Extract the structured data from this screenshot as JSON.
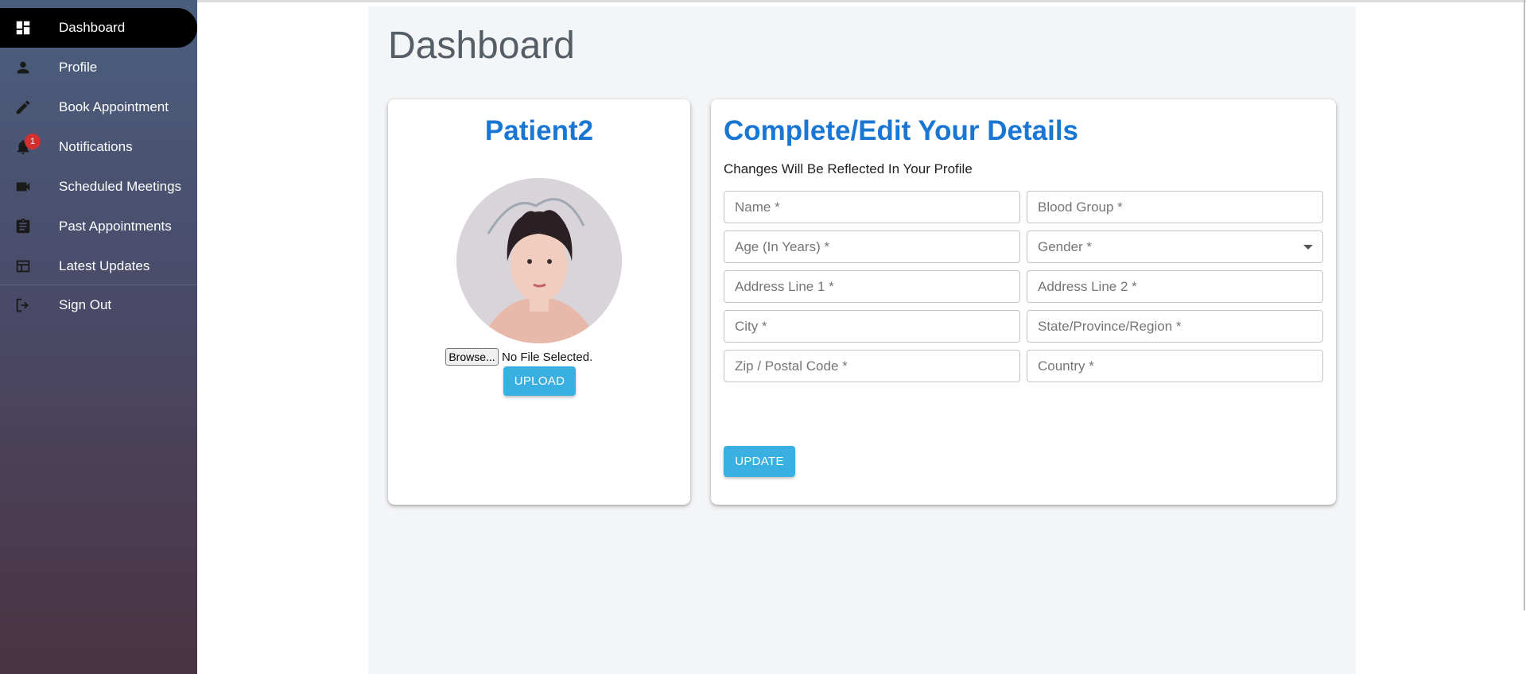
{
  "sidebar": {
    "items": [
      {
        "label": "Dashboard",
        "icon": "dashboard-icon",
        "active": true
      },
      {
        "label": "Profile",
        "icon": "person-icon"
      },
      {
        "label": "Book Appointment",
        "icon": "pencil-icon"
      },
      {
        "label": "Notifications",
        "icon": "bell-icon",
        "badge": "1"
      },
      {
        "label": "Scheduled Meetings",
        "icon": "video-camera-icon"
      },
      {
        "label": "Past Appointments",
        "icon": "clipboard-icon"
      },
      {
        "label": "Latest Updates",
        "icon": "table-icon"
      },
      {
        "label": "Sign Out",
        "icon": "sign-out-icon"
      }
    ]
  },
  "main": {
    "title": "Dashboard",
    "profile_card": {
      "name": "Patient2",
      "browse_label": "Browse...",
      "file_status": "No File Selected.",
      "upload_label": "UPLOAD"
    },
    "details_card": {
      "title": "Complete/Edit Your Details",
      "subtitle": "Changes Will Be Reflected In Your Profile",
      "fields": [
        {
          "label": "Name *"
        },
        {
          "label": "Blood Group *"
        },
        {
          "label": "Age (In Years) *"
        },
        {
          "label": "Gender *"
        },
        {
          "label": "Address Line 1 *"
        },
        {
          "label": "Address Line 2 *"
        },
        {
          "label": "City *"
        },
        {
          "label": "State/Province/Region *"
        },
        {
          "label": "Zip / Postal Code *"
        },
        {
          "label": "Country *"
        }
      ],
      "update_label": "UPDATE"
    }
  },
  "colors": {
    "accent_title": "#1976d2",
    "button": "#3ab0e2",
    "badge": "#d32f2f"
  }
}
